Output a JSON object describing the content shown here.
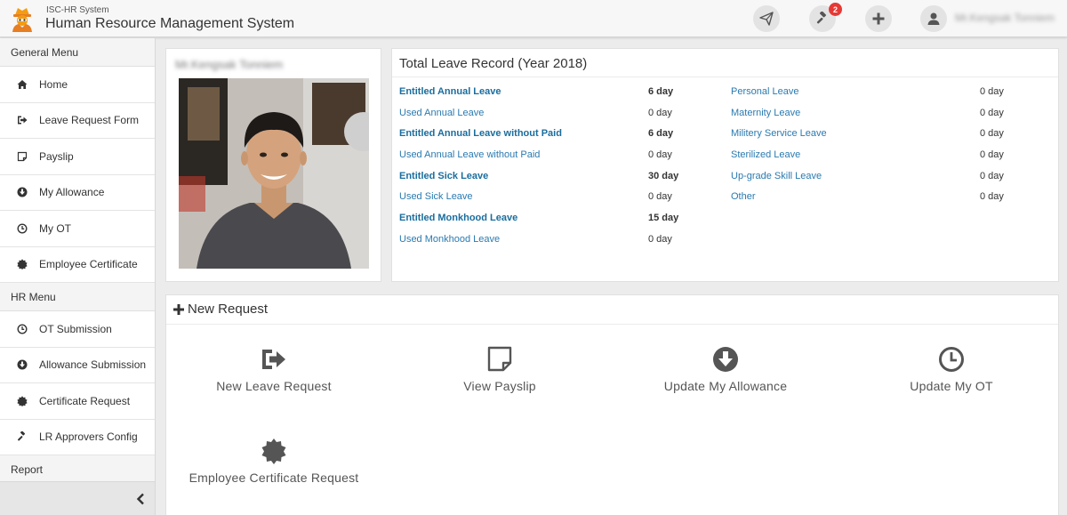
{
  "header": {
    "app_subtitle": "ISC-HR System",
    "app_title": "Human Resource Management System",
    "notification_count": "2",
    "user_name": "Mr.Kengsak Tonniem"
  },
  "sidebar": {
    "general_menu_label": "General Menu",
    "general_items": [
      {
        "label": "Home",
        "icon": "home-icon"
      },
      {
        "label": "Leave Request Form",
        "icon": "sign-out-icon"
      },
      {
        "label": "Payslip",
        "icon": "note-icon"
      },
      {
        "label": "My Allowance",
        "icon": "arrow-circle-down-icon"
      },
      {
        "label": "My OT",
        "icon": "clock-icon"
      },
      {
        "label": "Employee Certificate",
        "icon": "certificate-icon"
      }
    ],
    "hr_menu_label": "HR Menu",
    "hr_items": [
      {
        "label": "OT Submission",
        "icon": "clock-icon"
      },
      {
        "label": "Allowance Submission",
        "icon": "arrow-circle-down-icon"
      },
      {
        "label": "Certificate Request",
        "icon": "certificate-icon"
      },
      {
        "label": "LR Approvers Config",
        "icon": "gavel-icon"
      }
    ],
    "report_label": "Report"
  },
  "profile": {
    "name": "Mr.Kengsak Tonniem"
  },
  "leave": {
    "title": "Total Leave Record (Year 2018)",
    "left": [
      {
        "name": "Entitled Annual Leave",
        "value": "6 day",
        "bold": true
      },
      {
        "name": "Used Annual Leave",
        "value": "0 day",
        "bold": false
      },
      {
        "name": "Entitled Annual Leave without Paid",
        "value": "6 day",
        "bold": true
      },
      {
        "name": "Used Annual Leave without Paid",
        "value": "0 day",
        "bold": false
      },
      {
        "name": "Entitled Sick Leave",
        "value": "30 day",
        "bold": true
      },
      {
        "name": "Used Sick Leave",
        "value": "0 day",
        "bold": false
      },
      {
        "name": "Entitled Monkhood Leave",
        "value": "15 day",
        "bold": true
      },
      {
        "name": "Used Monkhood Leave",
        "value": "0 day",
        "bold": false
      }
    ],
    "right": [
      {
        "name": "Personal Leave",
        "value": "0 day"
      },
      {
        "name": "Maternity Leave",
        "value": "0 day"
      },
      {
        "name": "Militery Service Leave",
        "value": "0 day"
      },
      {
        "name": "Sterilized Leave",
        "value": "0 day"
      },
      {
        "name": "Up-grade Skill Leave",
        "value": "0 day"
      },
      {
        "name": "Other",
        "value": "0 day"
      }
    ]
  },
  "new_request": {
    "title": "New Request",
    "tiles": [
      {
        "label": "New Leave Request",
        "icon": "sign-out-icon"
      },
      {
        "label": "View Payslip",
        "icon": "note-icon"
      },
      {
        "label": "Update My Allowance",
        "icon": "arrow-circle-down-icon"
      },
      {
        "label": "Update My OT",
        "icon": "clock-icon"
      },
      {
        "label": "Employee Certificate Request",
        "icon": "certificate-icon"
      }
    ]
  },
  "colors": {
    "link": "#2a7ab0",
    "badge": "#e53935",
    "logo": "#f39c12"
  }
}
